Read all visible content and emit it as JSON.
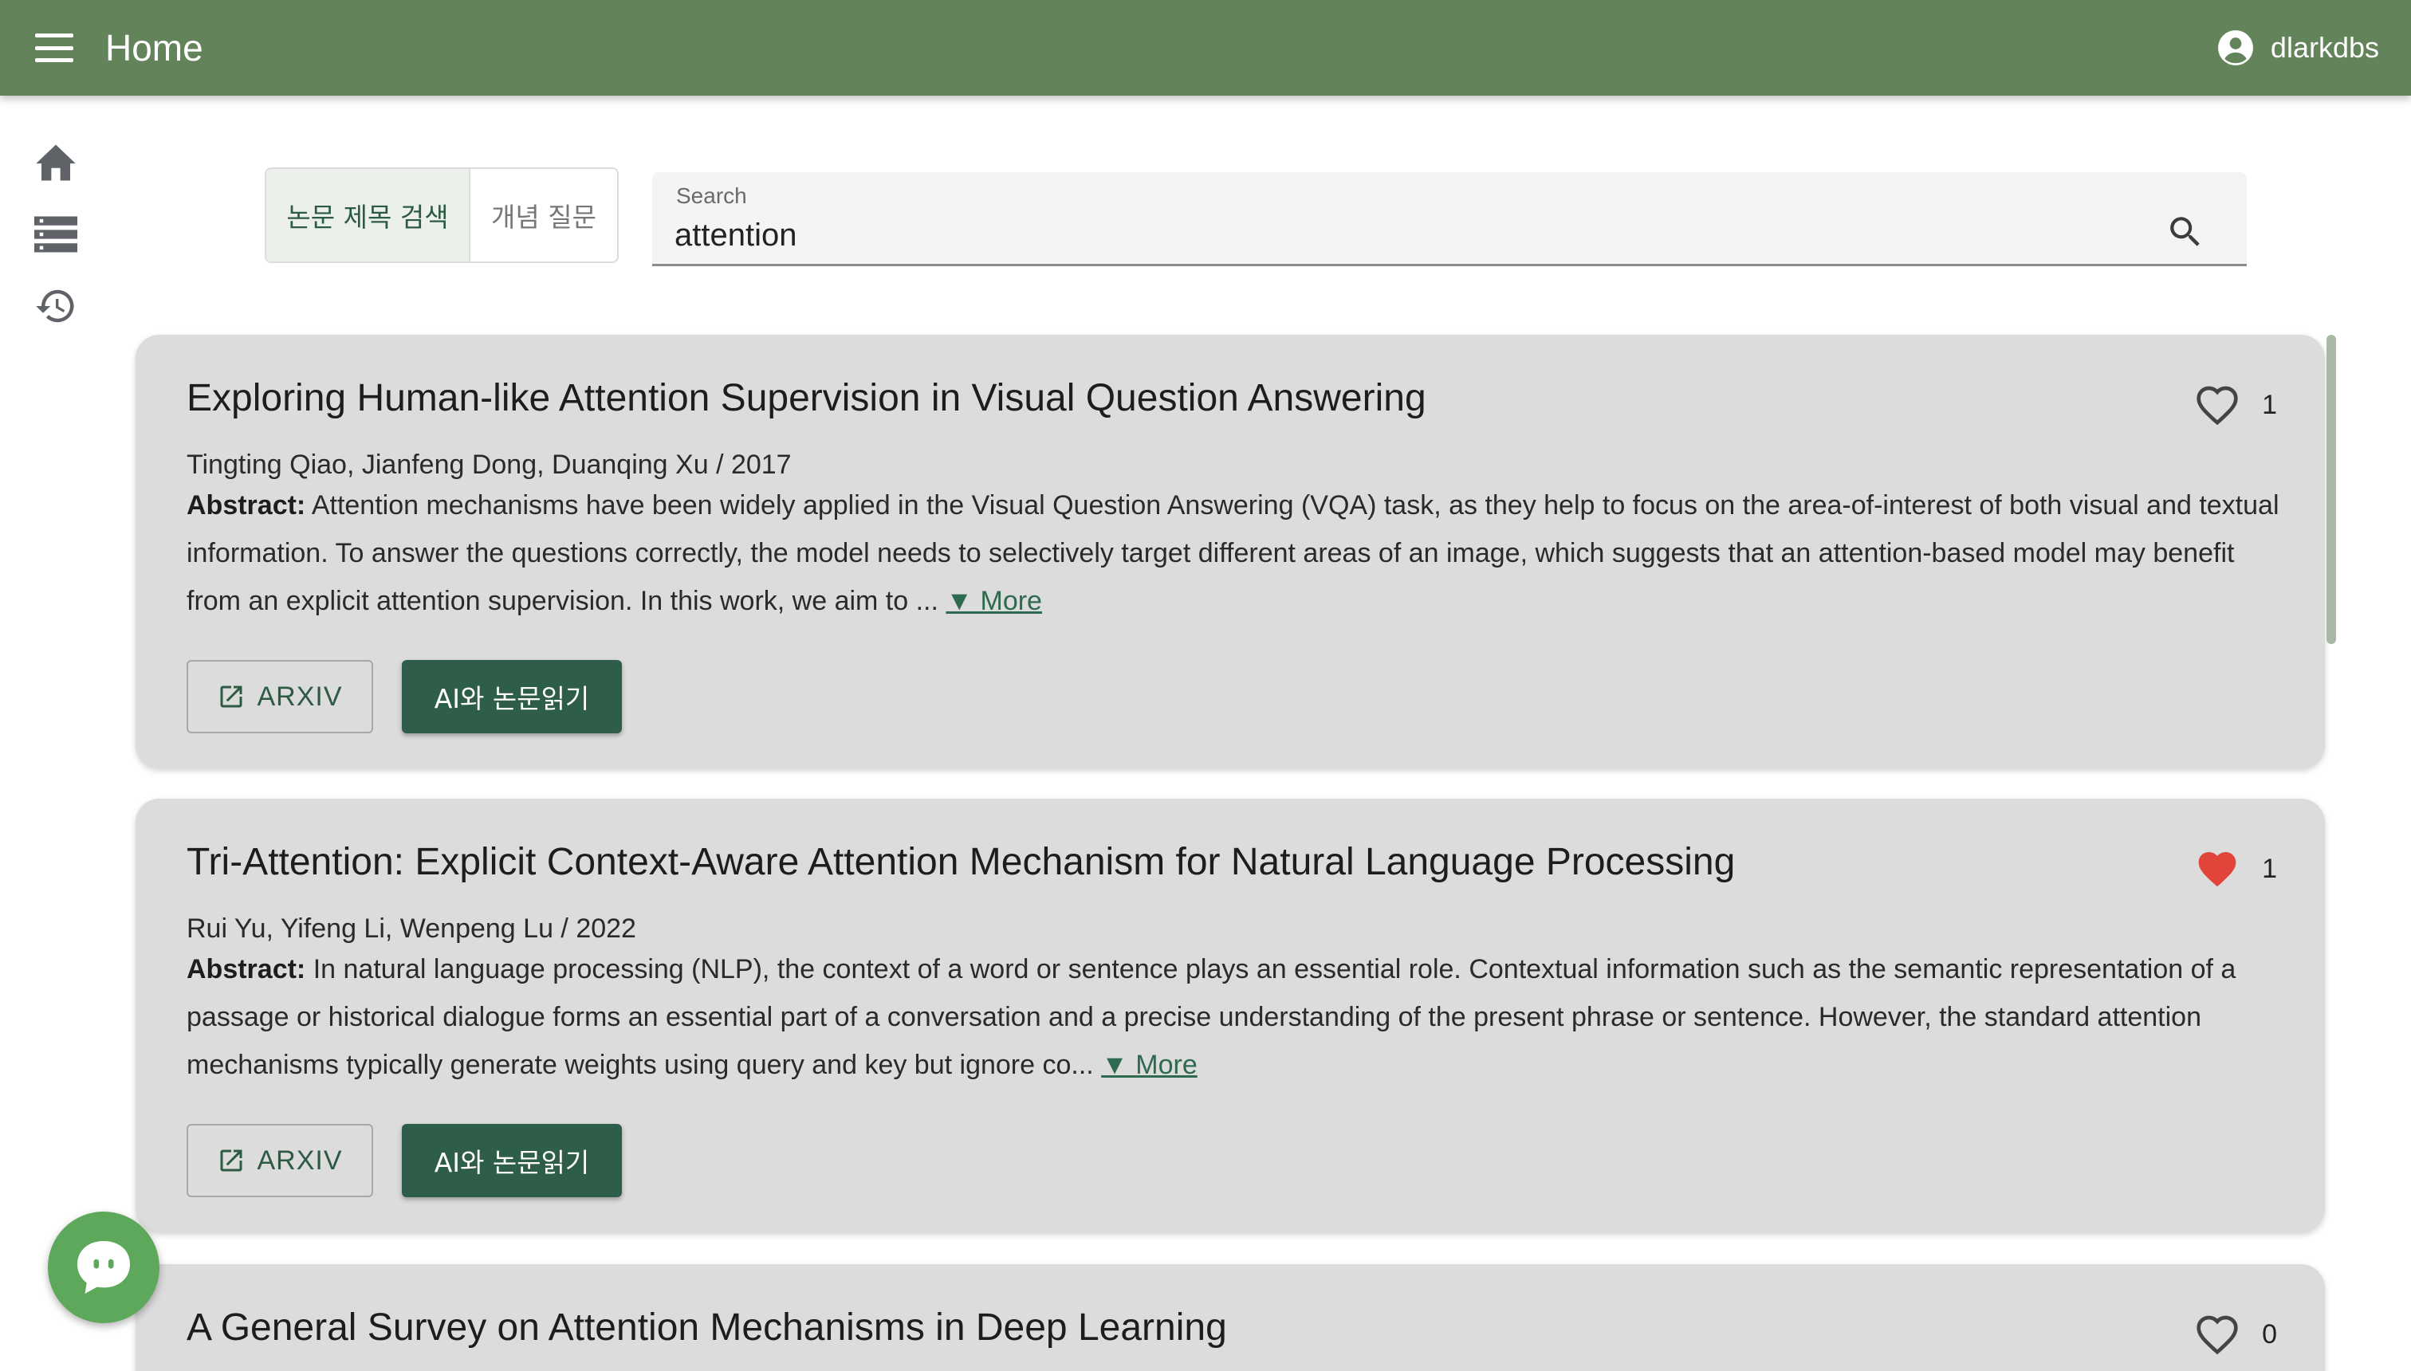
{
  "header": {
    "title": "Home",
    "username": "dlarkdbs"
  },
  "sidebar": {
    "items": [
      {
        "icon": "home-icon"
      },
      {
        "icon": "list-icon"
      },
      {
        "icon": "history-icon"
      }
    ]
  },
  "search": {
    "modes": [
      "논문 제목 검색",
      "개념 질문"
    ],
    "active_mode": "논문 제목 검색",
    "label": "Search",
    "value": "attention"
  },
  "results": [
    {
      "title": "Exploring Human-like Attention Supervision in Visual Question Answering",
      "meta": "Tingting Qiao, Jianfeng Dong, Duanqing Xu / 2017",
      "abstract_label": "Abstract:",
      "abstract": "Attention mechanisms have been widely applied in the Visual Question Answering (VQA) task, as they help to focus on the area-of-interest of both visual and textual information. To answer the questions correctly, the model needs to selectively target different areas of an image, which suggests that an attention-based model may benefit from an explicit attention supervision. In this work, we aim to ...",
      "more": "▼ More",
      "likes": "1",
      "liked": false,
      "arxiv_label": "ARXIV",
      "ai_label": "AI와 논문읽기"
    },
    {
      "title": "Tri-Attention: Explicit Context-Aware Attention Mechanism for Natural Language Processing",
      "meta": "Rui Yu, Yifeng Li, Wenpeng Lu / 2022",
      "abstract_label": "Abstract:",
      "abstract": "In natural language processing (NLP), the context of a word or sentence plays an essential role. Contextual information such as the semantic representation of a passage or historical dialogue forms an essential part of a conversation and a precise understanding of the present phrase or sentence. However, the standard attention mechanisms typically generate weights using query and key but ignore co...",
      "more": "▼ More",
      "likes": "1",
      "liked": true,
      "arxiv_label": "ARXIV",
      "ai_label": "AI와 논문읽기"
    },
    {
      "title": "A General Survey on Attention Mechanisms in Deep Learning",
      "likes": "0",
      "liked": false
    }
  ],
  "colors": {
    "header_bg": "#63835b",
    "card_bg": "#dcdcdc",
    "primary_button": "#2e5e4a",
    "liked_heart": "#e0443a",
    "chat_fab": "#5da85b"
  }
}
